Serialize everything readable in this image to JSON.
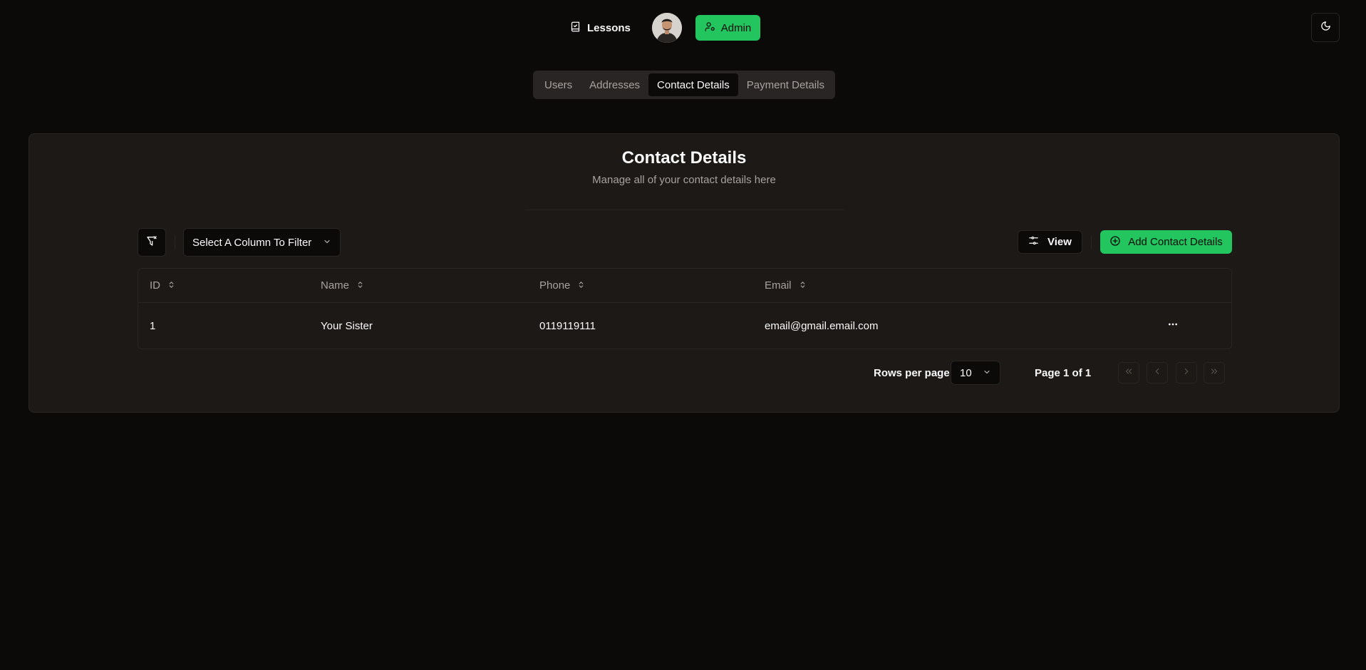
{
  "nav": {
    "lessons_label": "Lessons",
    "admin_label": "Admin",
    "accent_color": "#22c55e"
  },
  "tabs": [
    {
      "label": "Users",
      "active": false
    },
    {
      "label": "Addresses",
      "active": false
    },
    {
      "label": "Contact Details",
      "active": true
    },
    {
      "label": "Payment Details",
      "active": false
    }
  ],
  "card": {
    "title": "Contact Details",
    "subtitle": "Manage all of your contact details here"
  },
  "toolbar": {
    "column_filter_label": "Select A Column To Filter",
    "view_label": "View",
    "add_label": "Add Contact Details"
  },
  "table": {
    "columns": [
      "ID",
      "Name",
      "Phone",
      "Email"
    ],
    "rows": [
      {
        "id": "1",
        "name": "Your Sister",
        "phone": "0119119111",
        "email": "email@gmail.email.com"
      }
    ]
  },
  "pagination": {
    "rows_per_page_label": "Rows per page",
    "rows_per_page_value": "10",
    "page_info": "Page 1 of 1"
  },
  "icons": {
    "lessons": "notebook-icon",
    "admin": "user-cog-icon",
    "theme": "moon-icon",
    "filter": "filter-x-icon",
    "view": "sliders-icon",
    "add": "plus-circle-icon",
    "sort": "chevrons-up-down-icon",
    "row_actions": "ellipsis-icon"
  }
}
